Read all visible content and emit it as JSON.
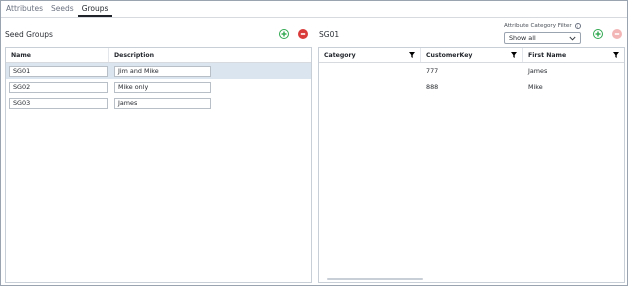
{
  "tabs": [
    {
      "label": "Attributes"
    },
    {
      "label": "Seeds"
    },
    {
      "label": "Groups"
    }
  ],
  "left": {
    "title": "Seed Groups",
    "columns": [
      "Name",
      "Description"
    ],
    "rows": [
      {
        "name": "SG01",
        "description": "Jim and Mike"
      },
      {
        "name": "SG02",
        "description": "Mike only"
      },
      {
        "name": "SG03",
        "description": "James"
      }
    ]
  },
  "right": {
    "title": "SG01",
    "filter_label": "Attribute Category Filter",
    "filter_value": "Show all",
    "columns": [
      "Category",
      "CustomerKey",
      "First Name"
    ],
    "rows": [
      {
        "category": "",
        "customer_key": "777",
        "first_name": "James"
      },
      {
        "category": "",
        "customer_key": "888",
        "first_name": "Mike"
      }
    ]
  },
  "icons": {
    "add": "plus-circle-icon",
    "remove": "minus-circle-icon",
    "filter": "funnel-icon",
    "info": "info-icon",
    "dropdown": "chevron-down-icon"
  },
  "colors": {
    "add": "#2fa84f",
    "remove": "#d93a3a",
    "remove_disabled": "#f3b6b6",
    "selected_row": "#dbe5f0"
  }
}
